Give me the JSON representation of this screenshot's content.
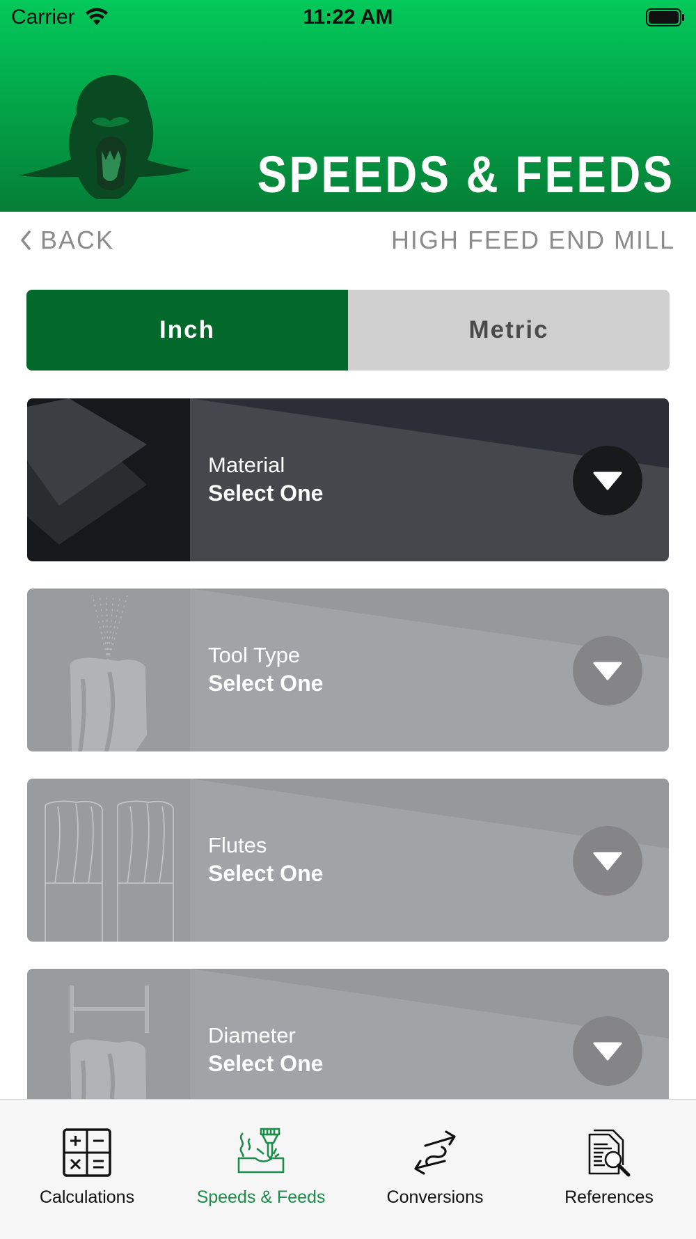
{
  "status_bar": {
    "carrier": "Carrier",
    "time": "11:22 AM"
  },
  "header": {
    "title": "SPEEDS & FEEDS"
  },
  "nav": {
    "back_label": "BACK",
    "subtitle": "HIGH FEED END MILL"
  },
  "unit_toggle": {
    "options": [
      "Inch",
      "Metric"
    ],
    "selected": "Inch"
  },
  "selectors": [
    {
      "label": "Material",
      "value": "Select One",
      "state": "enabled"
    },
    {
      "label": "Tool Type",
      "value": "Select One",
      "state": "disabled"
    },
    {
      "label": "Flutes",
      "value": "Select One",
      "state": "disabled"
    },
    {
      "label": "Diameter",
      "value": "Select One",
      "state": "disabled"
    }
  ],
  "tabs": [
    {
      "label": "Calculations",
      "icon": "calculator-icon"
    },
    {
      "label": "Speeds & Feeds",
      "icon": "milling-tool-icon",
      "active": true
    },
    {
      "label": "Conversions",
      "icon": "conversion-arrows-icon"
    },
    {
      "label": "References",
      "icon": "document-search-icon"
    }
  ],
  "colors": {
    "header_top": "#03c95a",
    "header_bottom": "#057f36",
    "active_green": "#02692a",
    "tab_active_text": "#1a8d48"
  }
}
